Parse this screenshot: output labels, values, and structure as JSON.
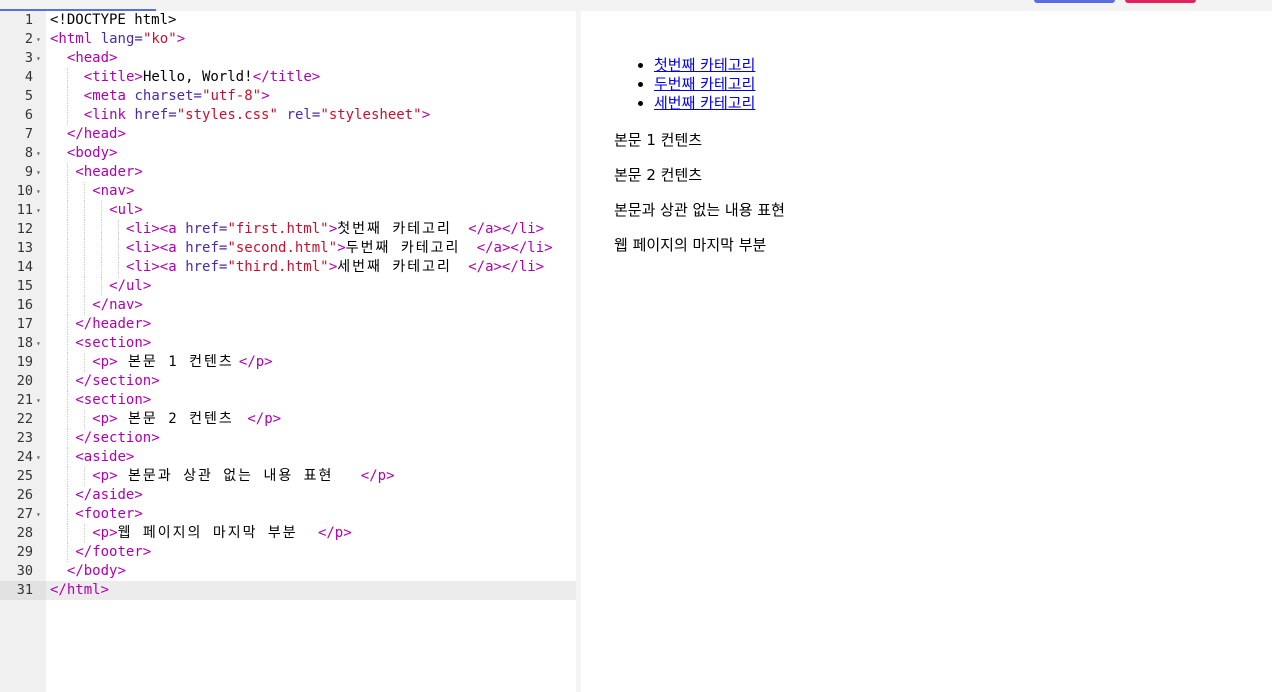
{
  "editor": {
    "active_line": 31,
    "lines": [
      {
        "n": 1,
        "indent": 0,
        "fold": false,
        "tokens": [
          {
            "t": "txt",
            "v": "<!DOCTYPE html>"
          }
        ]
      },
      {
        "n": 2,
        "indent": 0,
        "fold": true,
        "tokens": [
          {
            "t": "tag",
            "v": "<html "
          },
          {
            "t": "attr",
            "v": "lang="
          },
          {
            "t": "str",
            "v": "\"ko\""
          },
          {
            "t": "tag",
            "v": ">"
          }
        ]
      },
      {
        "n": 3,
        "indent": 2,
        "fold": true,
        "tokens": [
          {
            "t": "tag",
            "v": "<head>"
          }
        ]
      },
      {
        "n": 4,
        "indent": 4,
        "fold": false,
        "tokens": [
          {
            "t": "tag",
            "v": "<title>"
          },
          {
            "t": "txt",
            "v": "Hello, World!"
          },
          {
            "t": "tag",
            "v": "</title>"
          }
        ]
      },
      {
        "n": 5,
        "indent": 4,
        "fold": false,
        "tokens": [
          {
            "t": "tag",
            "v": "<meta "
          },
          {
            "t": "attr",
            "v": "charset="
          },
          {
            "t": "str",
            "v": "\"utf-8\""
          },
          {
            "t": "tag",
            "v": ">"
          }
        ]
      },
      {
        "n": 6,
        "indent": 4,
        "fold": false,
        "tokens": [
          {
            "t": "tag",
            "v": "<link "
          },
          {
            "t": "attr",
            "v": "href="
          },
          {
            "t": "str",
            "v": "\"styles.css\""
          },
          {
            "t": "attr",
            "v": " rel="
          },
          {
            "t": "str",
            "v": "\"stylesheet\""
          },
          {
            "t": "tag",
            "v": ">"
          }
        ]
      },
      {
        "n": 7,
        "indent": 2,
        "fold": false,
        "tokens": [
          {
            "t": "tag",
            "v": "</head>"
          }
        ]
      },
      {
        "n": 8,
        "indent": 2,
        "fold": true,
        "tokens": [
          {
            "t": "tag",
            "v": "<body>"
          }
        ]
      },
      {
        "n": 9,
        "indent": 3,
        "fold": true,
        "tokens": [
          {
            "t": "tag",
            "v": "<header>"
          }
        ]
      },
      {
        "n": 10,
        "indent": 5,
        "fold": true,
        "tokens": [
          {
            "t": "tag",
            "v": "<nav>"
          }
        ]
      },
      {
        "n": 11,
        "indent": 7,
        "fold": true,
        "tokens": [
          {
            "t": "tag",
            "v": "<ul>"
          }
        ]
      },
      {
        "n": 12,
        "indent": 9,
        "fold": false,
        "tokens": [
          {
            "t": "tag",
            "v": "<li><a "
          },
          {
            "t": "attr",
            "v": "href="
          },
          {
            "t": "str",
            "v": "\"first.html\""
          },
          {
            "t": "tag",
            "v": ">"
          },
          {
            "t": "kr",
            "v": "첫번째 카테고리"
          },
          {
            "t": "tag",
            "v": "</a></li>"
          }
        ]
      },
      {
        "n": 13,
        "indent": 9,
        "fold": false,
        "tokens": [
          {
            "t": "tag",
            "v": "<li><a "
          },
          {
            "t": "attr",
            "v": "href="
          },
          {
            "t": "str",
            "v": "\"second.html\""
          },
          {
            "t": "tag",
            "v": ">"
          },
          {
            "t": "kr",
            "v": "두번째 카테고리"
          },
          {
            "t": "tag",
            "v": "</a></li>"
          }
        ]
      },
      {
        "n": 14,
        "indent": 9,
        "fold": false,
        "tokens": [
          {
            "t": "tag",
            "v": "<li><a "
          },
          {
            "t": "attr",
            "v": "href="
          },
          {
            "t": "str",
            "v": "\"third.html\""
          },
          {
            "t": "tag",
            "v": ">"
          },
          {
            "t": "kr",
            "v": "세번째 카테고리"
          },
          {
            "t": "tag",
            "v": "</a></li>"
          }
        ]
      },
      {
        "n": 15,
        "indent": 7,
        "fold": false,
        "tokens": [
          {
            "t": "tag",
            "v": "</ul>"
          }
        ]
      },
      {
        "n": 16,
        "indent": 5,
        "fold": false,
        "tokens": [
          {
            "t": "tag",
            "v": "</nav>"
          }
        ]
      },
      {
        "n": 17,
        "indent": 3,
        "fold": false,
        "tokens": [
          {
            "t": "tag",
            "v": "</header>"
          }
        ]
      },
      {
        "n": 18,
        "indent": 3,
        "fold": true,
        "tokens": [
          {
            "t": "tag",
            "v": "<section>"
          }
        ]
      },
      {
        "n": 19,
        "indent": 5,
        "fold": false,
        "tokens": [
          {
            "t": "tag",
            "v": "<p>"
          },
          {
            "t": "kr",
            "v": " 본문 1 컨텐츠"
          },
          {
            "t": "tag",
            "v": "</p>"
          }
        ]
      },
      {
        "n": 20,
        "indent": 3,
        "fold": false,
        "tokens": [
          {
            "t": "tag",
            "v": "</section>"
          }
        ]
      },
      {
        "n": 21,
        "indent": 3,
        "fold": true,
        "tokens": [
          {
            "t": "tag",
            "v": "<section>"
          }
        ]
      },
      {
        "n": 22,
        "indent": 5,
        "fold": false,
        "tokens": [
          {
            "t": "tag",
            "v": "<p>"
          },
          {
            "t": "kr",
            "v": " 본문 2 컨텐츠 "
          },
          {
            "t": "tag",
            "v": "</p>"
          }
        ]
      },
      {
        "n": 23,
        "indent": 3,
        "fold": false,
        "tokens": [
          {
            "t": "tag",
            "v": "</section>"
          }
        ]
      },
      {
        "n": 24,
        "indent": 3,
        "fold": true,
        "tokens": [
          {
            "t": "tag",
            "v": "<aside>"
          }
        ]
      },
      {
        "n": 25,
        "indent": 5,
        "fold": false,
        "tokens": [
          {
            "t": "tag",
            "v": "<p>"
          },
          {
            "t": "kr",
            "v": " 본문과 상관 없는 내용 표현 "
          },
          {
            "t": "tag",
            "v": "</p>"
          }
        ]
      },
      {
        "n": 26,
        "indent": 3,
        "fold": false,
        "tokens": [
          {
            "t": "tag",
            "v": "</aside>"
          }
        ]
      },
      {
        "n": 27,
        "indent": 3,
        "fold": true,
        "tokens": [
          {
            "t": "tag",
            "v": "<footer>"
          }
        ]
      },
      {
        "n": 28,
        "indent": 5,
        "fold": false,
        "tokens": [
          {
            "t": "tag",
            "v": "<p>"
          },
          {
            "t": "kr",
            "v": "웹 페이지의 마지막 부분"
          },
          {
            "t": "tag",
            "v": "</p>"
          }
        ]
      },
      {
        "n": 29,
        "indent": 3,
        "fold": false,
        "tokens": [
          {
            "t": "tag",
            "v": "</footer>"
          }
        ]
      },
      {
        "n": 30,
        "indent": 2,
        "fold": false,
        "tokens": [
          {
            "t": "tag",
            "v": "</body>"
          }
        ]
      },
      {
        "n": 31,
        "indent": 0,
        "fold": false,
        "tokens": [
          {
            "t": "tag",
            "v": "</html>"
          }
        ]
      }
    ]
  },
  "preview": {
    "nav_items": [
      "첫번째 카테고리",
      "두번째 카테고리",
      "세번째 카테고리"
    ],
    "paragraphs": [
      "본문 1 컨텐츠",
      "본문 2 컨텐츠",
      "본문과 상관 없는 내용 표현",
      "웹 페이지의 마지막 부분"
    ]
  },
  "colors": {
    "tag": "#b000b0",
    "attr": "#4b2aa8",
    "string": "#c8102e",
    "link": "#0000ee",
    "accent_blue": "#5b6ee1",
    "accent_red": "#e0245e"
  }
}
